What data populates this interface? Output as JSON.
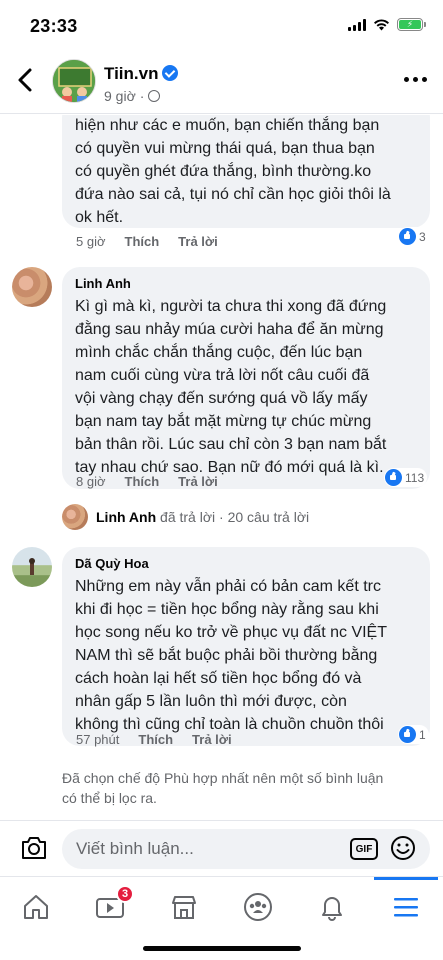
{
  "status_bar": {
    "time": "23:33",
    "battery_charging": true
  },
  "header": {
    "page_name": "Tiin.vn",
    "verified": true,
    "post_time": "9 giờ",
    "privacy_icon": "globe-icon"
  },
  "comments": [
    {
      "author": "",
      "text": "hiện như các e muốn, bạn chiến thắng bạn có quyền vui mừng thái quá, bạn thua bạn có quyền ghét đứa thắng, bình thường.ko đứa nào sai cả, tụi nó chỉ cần học giỏi thôi là ok hết.",
      "lines": [
        "hiện như các e muốn, bạn chiến thắng bạn",
        "có quyền vui mừng thái quá, bạn thua bạn",
        "có quyền ghét đứa thắng, bình thường.ko",
        "đứa nào sai cả, tụi nó chỉ cần học giỏi thôi là",
        "ok hết."
      ],
      "time": "5 giờ",
      "like_label": "Thích",
      "reply_label": "Trả lời",
      "reaction_count": "3"
    },
    {
      "author": "Linh Anh",
      "lines": [
        "Kì gì mà kì, người ta chưa thi xong đã đứng",
        "đằng sau nhảy múa cười haha để ăn mừng",
        "mình chắc chắn thắng cuộc, đến lúc bạn",
        "nam cuối cùng vừa trả lời nốt câu cuối đã",
        "vội vàng chạy đến sướng quá vồ lấy mấy",
        "bạn nam tay bắt mặt mừng tự chúc mừng",
        "bản thân rồi. Lúc sau chỉ còn 3 bạn nam bắt",
        "tay nhau chứ sao. Bạn nữ đó mới quá là kì."
      ],
      "time": "8 giờ",
      "like_label": "Thích",
      "reply_label": "Trả lời",
      "reaction_count": "113",
      "replies_summary": {
        "author": "Linh Anh",
        "action": "đã trả lời",
        "separator": "·",
        "count_text": "20 câu trả lời"
      }
    },
    {
      "author": "Dã Quỳ Hoa",
      "lines": [
        "Những em này vẫn phải có bản cam kết trc",
        "khi đi học  = tiền học bổng này rằng sau khi",
        "học song nếu ko trở về phục vụ đất nc VIỆT",
        "NAM thì sẽ bắt buộc phải bồi thường bằng",
        "cách hoàn lại hết số tiền học bổng đó và",
        "nhân gấp 5 lần luôn thì mới được, còn",
        "không thì cũng chỉ toàn là chuồn chuồn thôi"
      ],
      "time": "57 phút",
      "like_label": "Thích",
      "reply_label": "Trả lời",
      "reaction_count": "1"
    }
  ],
  "notice_text": "Đã chọn chế độ Phù hợp nhất nên một số bình luận có thể bị lọc ra.",
  "composer": {
    "placeholder": "Viết bình luận...",
    "gif_label": "GIF"
  },
  "tabbar": {
    "tabs": [
      "home-icon",
      "watch-icon",
      "marketplace-icon",
      "groups-icon",
      "notifications-icon",
      "menu-icon"
    ],
    "watch_badge": "3",
    "active_tab": "menu-icon"
  },
  "colors": {
    "accent": "#1877f2",
    "bubble": "#f0f2f5",
    "badge": "#e41e3f",
    "muted": "#65676b"
  }
}
